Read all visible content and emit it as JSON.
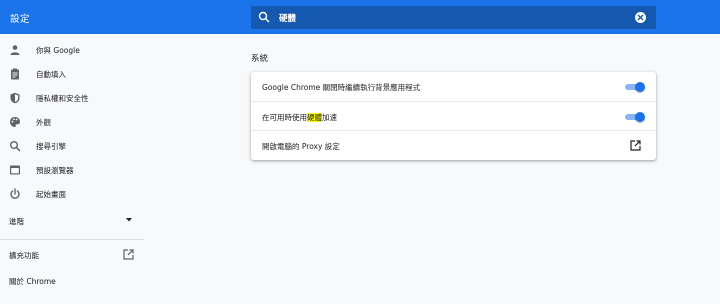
{
  "header": {
    "title": "設定",
    "search": {
      "value": "硬體"
    }
  },
  "sidebar": {
    "items": [
      {
        "label": "你與 Google",
        "icon": "person-icon"
      },
      {
        "label": "自動填入",
        "icon": "clipboard-icon"
      },
      {
        "label": "隱私權和安全性",
        "icon": "shield-icon"
      },
      {
        "label": "外觀",
        "icon": "palette-icon"
      },
      {
        "label": "搜尋引擎",
        "icon": "search-icon"
      },
      {
        "label": "預設瀏覽器",
        "icon": "browser-icon"
      },
      {
        "label": "起始畫面",
        "icon": "power-icon"
      }
    ],
    "advanced": "進階",
    "extensions": "擴充功能",
    "about": "關於 Chrome"
  },
  "main": {
    "section_title": "系統",
    "rows": [
      {
        "label": "Google Chrome 關閉時繼續執行背景應用程式",
        "control": "toggle",
        "on": true
      },
      {
        "label_before": "在可用時使用",
        "label_highlight": "硬體",
        "label_after": "加速",
        "control": "toggle",
        "on": true
      },
      {
        "label": "開啟電腦的 Proxy 設定",
        "control": "open-in-new-icon"
      }
    ]
  },
  "colors": {
    "accent": "#1a73e8",
    "search_bg": "#1558b0",
    "highlight": "#ffff00",
    "background": "#f8f9fa"
  }
}
